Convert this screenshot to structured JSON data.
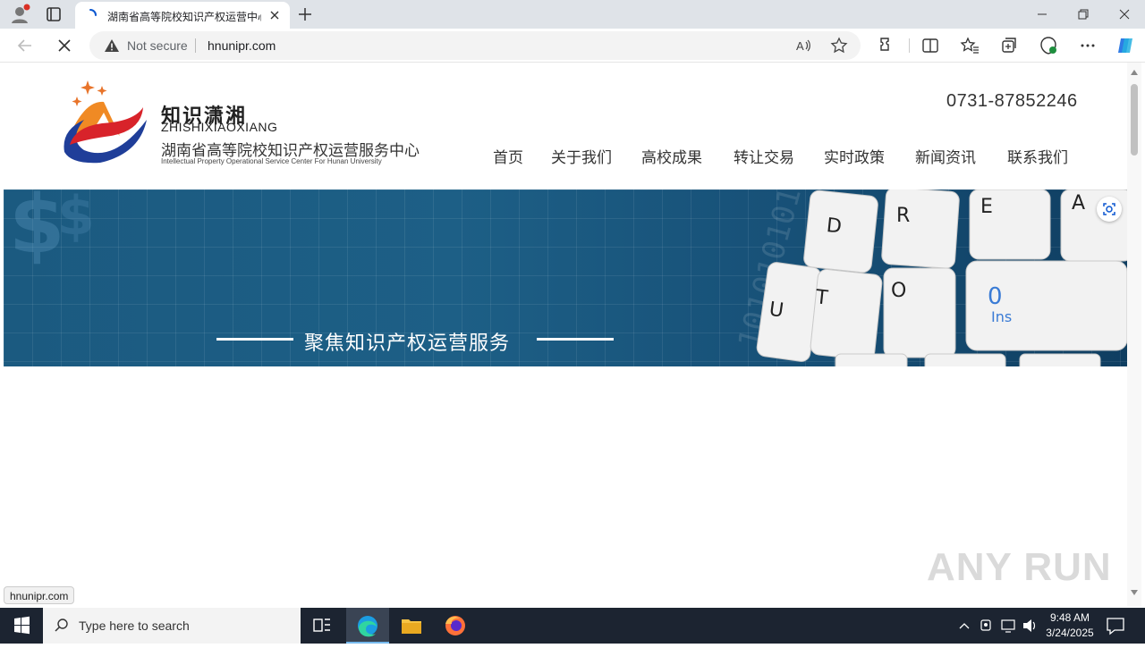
{
  "browser": {
    "tab_title": "湖南省高等院校知识产权运营中心",
    "security_label": "Not secure",
    "url": "hnunipr.com",
    "status_url": "hnunipr.com"
  },
  "site": {
    "logo_cn": "知识潇湘",
    "logo_pinyin": "ZHISHIXIAOXIANG",
    "logo_full_name": "湖南省高等院校知识产权运营服务中心",
    "logo_en": "Intellectual Property Operational Service Center For Hunan University",
    "phone": "0731-87852246",
    "nav": [
      "首页",
      "关于我们",
      "高校成果",
      "转让交易",
      "实时政策",
      "新闻资讯",
      "联系我们"
    ],
    "banner_slogan": "聚焦知识产权运营服务",
    "banner_keys": [
      "D",
      "R",
      "E",
      "A",
      "U",
      "T",
      "O",
      "0",
      "Ins"
    ]
  },
  "watermark": "ANY RUN",
  "taskbar": {
    "search_placeholder": "Type here to search",
    "time": "9:48 AM",
    "date": "3/24/2025"
  },
  "colors": {
    "banner_blue": "#1b5a80",
    "taskbar": "#1c2431",
    "accent": "#0078d4"
  }
}
